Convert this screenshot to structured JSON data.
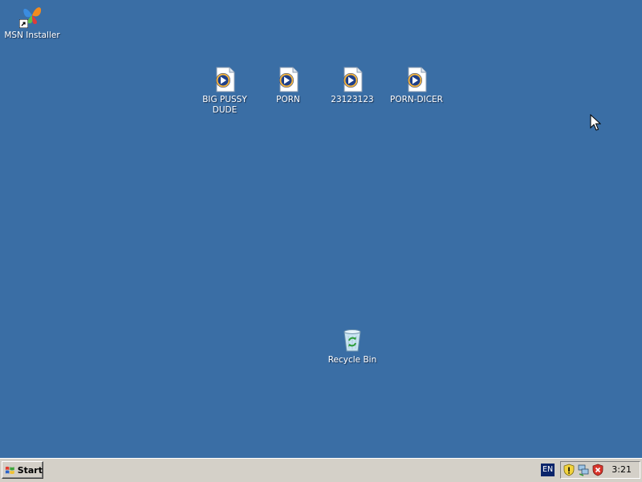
{
  "desktop": {
    "background_color": "#3a6ea5",
    "icons": [
      {
        "label": "MSN Installer",
        "icon": "msn-butterfly-icon",
        "shortcut": true
      },
      {
        "label": "BIG PUSSY DUDE",
        "icon": "media-file-icon"
      },
      {
        "label": "PORN",
        "icon": "media-file-icon"
      },
      {
        "label": "23123123",
        "icon": "media-file-icon"
      },
      {
        "label": "PORN-DICER",
        "icon": "media-file-icon"
      },
      {
        "label": "Recycle Bin",
        "icon": "recycle-bin-icon"
      }
    ]
  },
  "taskbar": {
    "start_label": "Start",
    "language": "EN",
    "tray_icons": [
      "security-alert-icon",
      "network-icon",
      "shield-icon"
    ],
    "clock": "3:21"
  }
}
